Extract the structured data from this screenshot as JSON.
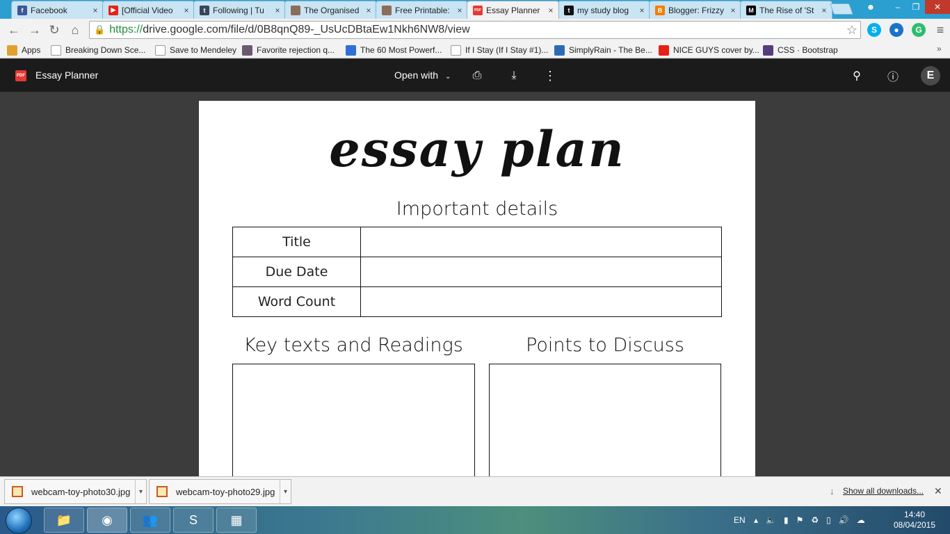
{
  "browser": {
    "tabs": [
      {
        "label": "Facebook",
        "icon": "facebook-icon",
        "color": "#3b5998",
        "glyph": "f"
      },
      {
        "label": "[Official Video",
        "icon": "youtube-icon",
        "color": "#e62117",
        "glyph": "▶"
      },
      {
        "label": "Following | Tu",
        "icon": "tumblr-icon",
        "color": "#36465d",
        "glyph": "t"
      },
      {
        "label": "The Organised",
        "icon": "profile-photo-icon",
        "color": "#8a6d5a",
        "glyph": ""
      },
      {
        "label": "Free Printable:",
        "icon": "profile-photo-icon",
        "color": "#8a6d5a",
        "glyph": ""
      },
      {
        "label": "Essay Planner",
        "icon": "pdf-icon",
        "color": "#e53935",
        "glyph": "PDF"
      },
      {
        "label": "my study blog",
        "icon": "tumblr-icon",
        "color": "#111111",
        "glyph": "t"
      },
      {
        "label": "Blogger: Frizzy",
        "icon": "blogger-icon",
        "color": "#f57d00",
        "glyph": "B"
      },
      {
        "label": "The Rise of 'St",
        "icon": "medium-icon",
        "color": "#000000",
        "glyph": "M"
      }
    ],
    "url_secure": "https://",
    "url_rest": "drive.google.com/file/d/0B8qnQ89-_UsUcDBtaEw1Nkh6NW8/view",
    "bookmarks": [
      {
        "label": "Apps",
        "icon": "apps-grid-icon",
        "color": "#e0a030"
      },
      {
        "label": "Breaking Down Sce...",
        "icon": "page-icon",
        "color": "#ffffff"
      },
      {
        "label": "Save to Mendeley",
        "icon": "page-icon",
        "color": "#ffffff"
      },
      {
        "label": "Favorite rejection q...",
        "icon": "photo-icon",
        "color": "#6a5a70"
      },
      {
        "label": "The 60 Most Powerf...",
        "icon": "d-icon",
        "color": "#2f6fd6"
      },
      {
        "label": "If I Stay (If I Stay #1)...",
        "icon": "page-icon",
        "color": "#ffffff"
      },
      {
        "label": "SimplyRain - The Be...",
        "icon": "rain-icon",
        "color": "#2d6cb3"
      },
      {
        "label": "NICE GUYS cover by...",
        "icon": "youtube-icon",
        "color": "#e62117"
      },
      {
        "label": "CSS · Bootstrap",
        "icon": "bootstrap-icon",
        "color": "#563d7c"
      }
    ]
  },
  "viewer": {
    "file_badge": "PDF",
    "title": "Essay Planner",
    "open_with": "Open with",
    "avatar_letter": "E"
  },
  "document": {
    "heading": "essay plan",
    "details_heading": "Important details",
    "details_rows": [
      {
        "label": "Title"
      },
      {
        "label": "Due Date"
      },
      {
        "label": "Word Count"
      }
    ],
    "left_heading": "Key texts and Readings",
    "right_heading": "Points to Discuss"
  },
  "downloads": {
    "items": [
      {
        "name": "webcam-toy-photo30.jpg"
      },
      {
        "name": "webcam-toy-photo29.jpg"
      }
    ],
    "show_all": "Show all downloads..."
  },
  "taskbar": {
    "language": "EN",
    "time": "14:40",
    "date": "08/04/2015"
  }
}
